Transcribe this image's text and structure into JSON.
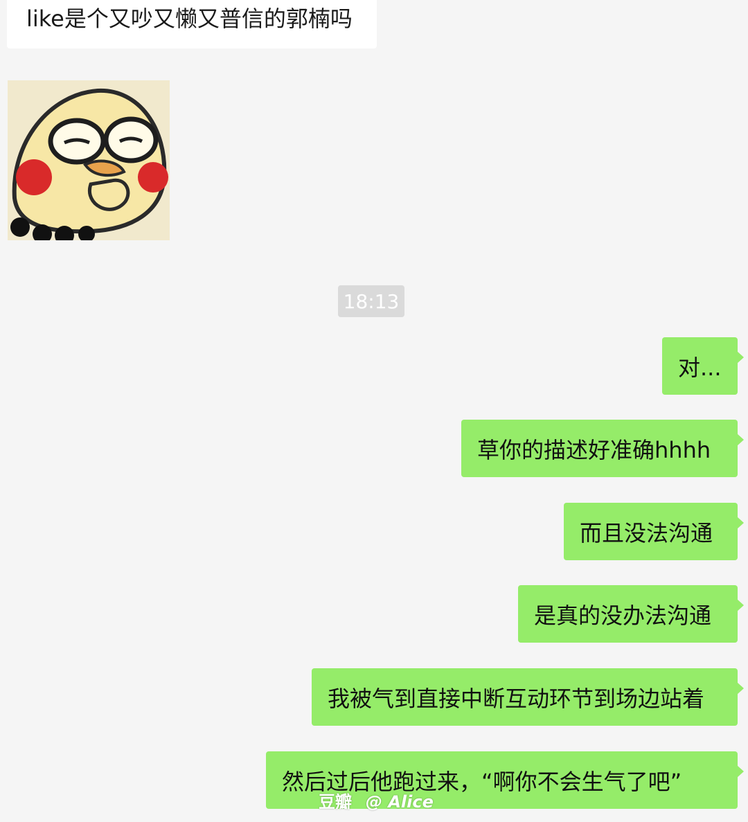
{
  "messages": {
    "incoming_text": "like是个又吵又懒又普信的郭楠吗",
    "sticker": {
      "icon": "blushing-cartoon-sticker-icon"
    },
    "timestamp": "18:13",
    "outgoing": [
      "对...",
      "草你的描述好准确hhhh",
      "而且没法沟通",
      "是真的没办法沟通",
      "我被气到直接中断互动环节到场边站着",
      "然后过后他跑过来，“啊你不会生气了吧”"
    ]
  },
  "watermark": {
    "site": "豆瓣",
    "handle": "@ Alice"
  },
  "colors": {
    "background": "#f5f5f5",
    "incoming_bubble": "#ffffff",
    "outgoing_bubble": "#95ec69",
    "timestamp_bg": "#dadada"
  }
}
